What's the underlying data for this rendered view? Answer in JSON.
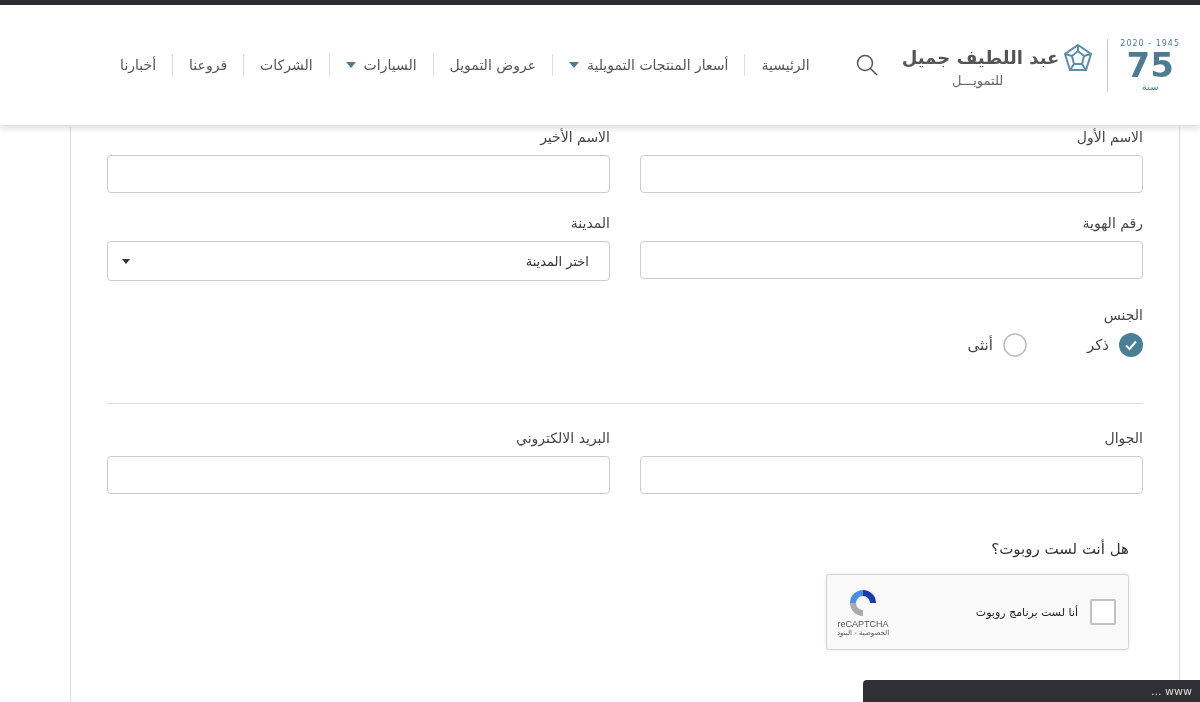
{
  "header": {
    "logo": {
      "years": "2020 - 1945",
      "number": "75",
      "word": "سنة",
      "brand_name": "عبد اللطيف جميل",
      "brand_sub": "للتمويـــل"
    },
    "nav": [
      {
        "label": "الرئيسية",
        "dropdown": false
      },
      {
        "label": "أسعار المنتجات التمويلية",
        "dropdown": true
      },
      {
        "label": "عروض التمويل",
        "dropdown": false
      },
      {
        "label": "السيارات",
        "dropdown": true
      },
      {
        "label": "الشركات",
        "dropdown": false
      },
      {
        "label": "فروعنا",
        "dropdown": false
      },
      {
        "label": "أخبارنا",
        "dropdown": false
      }
    ]
  },
  "form": {
    "rows": [
      [
        {
          "kind": "text",
          "label": "الاسم الأول"
        },
        {
          "kind": "text",
          "label": "الاسم الأخير"
        }
      ],
      [
        {
          "kind": "text",
          "label": "رقم الهوية"
        },
        {
          "kind": "select",
          "label": "المدينة",
          "value": "اختر المدينة"
        }
      ]
    ],
    "gender": {
      "label": "الجنس",
      "options": [
        {
          "label": "ذكر",
          "selected": true
        },
        {
          "label": "أنثى",
          "selected": false
        }
      ]
    },
    "contact_rows": [
      [
        {
          "kind": "text",
          "label": "الجوال"
        },
        {
          "kind": "text",
          "label": "البريد الالكتروني"
        }
      ]
    ],
    "captcha": {
      "question": "هل أنت لست روبوت؟",
      "checkbox_label": "أنا لست برنامج روبوت",
      "checked": false,
      "brand": "reCAPTCHA",
      "links": "الخصوصية - البنود"
    }
  },
  "toast": {
    "text": "... www"
  }
}
